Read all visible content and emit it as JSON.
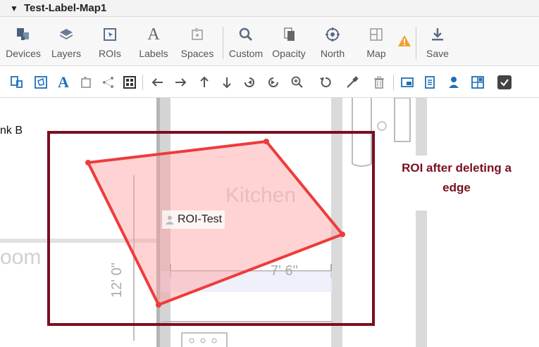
{
  "window": {
    "title": "Test-Label-Map1"
  },
  "toolbar": {
    "buttons": [
      {
        "label": "Devices",
        "icon": "devices-icon"
      },
      {
        "label": "Layers",
        "icon": "layers-icon"
      },
      {
        "label": "ROIs",
        "icon": "roi-icon"
      },
      {
        "label": "Labels",
        "icon": "labels-icon"
      },
      {
        "label": "Spaces",
        "icon": "spaces-icon"
      },
      {
        "label": "Custom",
        "icon": "search-icon"
      },
      {
        "label": "Opacity",
        "icon": "opacity-icon"
      },
      {
        "label": "North",
        "icon": "compass-icon"
      },
      {
        "label": "Map",
        "icon": "map-icon"
      },
      {
        "label": "Save",
        "icon": "save-icon"
      }
    ],
    "warning_icon": "warning-icon",
    "warning_color": "#f0a030"
  },
  "secondary_toolbar": {
    "icons": [
      "device-add-icon",
      "roi-edit-icon",
      "text-icon",
      "space-icon",
      "share-icon",
      "grid-icon",
      "arrow-left-icon",
      "arrow-right-icon",
      "arrow-up-icon",
      "arrow-down-icon",
      "rotate-left-icon",
      "rotate-right-icon",
      "zoom-in-icon",
      "undo-icon",
      "eyedropper-icon",
      "trash-icon",
      "window-icon",
      "document-icon",
      "user-icon",
      "layout-icon",
      "checkbox-icon"
    ],
    "accent": "#1e6fb8"
  },
  "canvas": {
    "partial_label": "nk B",
    "room_label": "Kitchen",
    "left_room_fragment": "oom",
    "dimension_vertical": "12' 0\"",
    "dimension_horizontal": "7' 6\"",
    "roi": {
      "label": "ROI-Test",
      "fill": "#ff9e9e",
      "stroke": "#ee3b3b"
    },
    "highlight_box_color": "#7a0f1f",
    "annotation": {
      "line1": "ROI after deleting a",
      "line2": "edge"
    }
  }
}
